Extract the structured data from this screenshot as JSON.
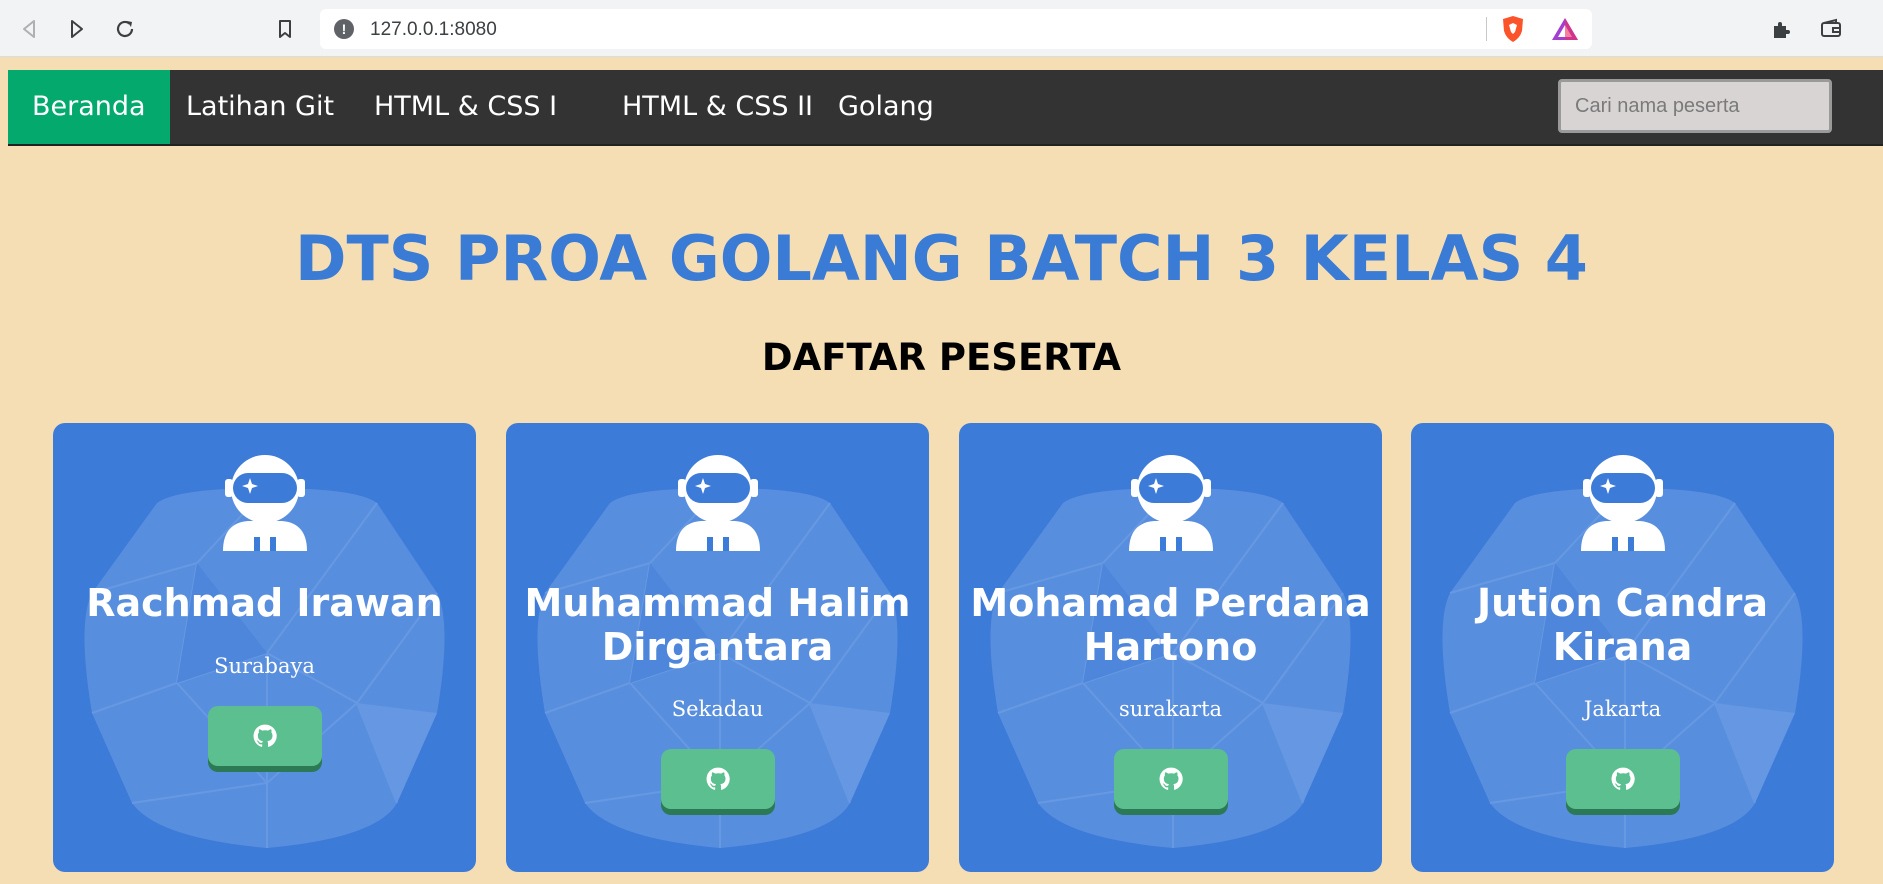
{
  "browser": {
    "url": "127.0.0.1:8080"
  },
  "nav": {
    "items": [
      {
        "label": "Beranda",
        "active": true
      },
      {
        "label": "Latihan Git",
        "active": false
      },
      {
        "label": "HTML & CSS I",
        "active": false
      },
      {
        "label": "HTML & CSS II",
        "active": false
      },
      {
        "label": "Golang",
        "active": false
      }
    ],
    "search_placeholder": "Cari nama peserta"
  },
  "page": {
    "title": "DTS PROA GOLANG BATCH 3 KELAS 4",
    "subtitle": "DAFTAR PESERTA"
  },
  "participants": [
    {
      "name": "Rachmad Irawan",
      "city": "Surabaya"
    },
    {
      "name": "Muhammad Halim Dirgantara",
      "city": "Sekadau"
    },
    {
      "name": "Mohamad Perdana Hartono",
      "city": "surakarta"
    },
    {
      "name": "Jution Candra Kirana",
      "city": "Jakarta"
    }
  ],
  "colors": {
    "page_bg": "#f5deb3",
    "navbar_bg": "#333333",
    "nav_active": "#04aa6d",
    "title": "#3a7bd5",
    "card_bg": "#3d7bd9",
    "github_button": "#5cbf8f"
  },
  "icons": {
    "avatar": "astronaut-icon",
    "github": "github-icon"
  }
}
